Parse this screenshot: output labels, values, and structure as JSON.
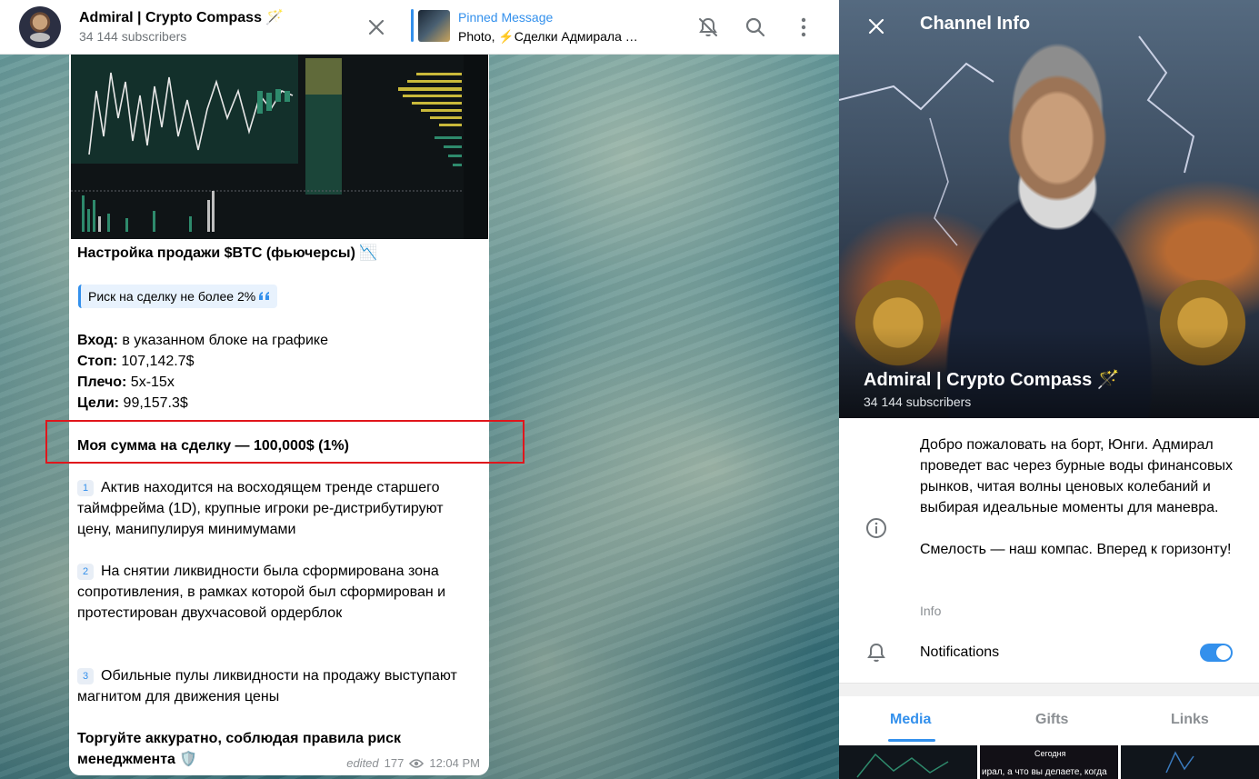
{
  "chat_header": {
    "title": "Admiral | Crypto Compass 🪄",
    "subscribers": "34 144 subscribers"
  },
  "pinned": {
    "title": "Pinned Message",
    "text": "Photo, ⚡Сделки Адмирала …"
  },
  "icons": {
    "close": "close-icon",
    "mute": "bell-off-icon",
    "search": "search-icon",
    "more": "more-vertical-icon",
    "info": "info-icon",
    "notifications": "bell-icon",
    "views": "eye-icon"
  },
  "message": {
    "heading": "Настройка продажи $BTC (фьючерсы) 📉",
    "risk_quote": "Риск на сделку не более 2%",
    "entry_label": "Вход:",
    "entry_value": " в указанном блоке на графике",
    "stop_label": "Стоп:",
    "stop_value": " 107,142.7$",
    "leverage_label": "Плечо:",
    "leverage_value": " 5x-15x",
    "targets_label": "Цели:",
    "targets_value": " 99,157.3$",
    "my_amount": "Моя сумма на сделку — 100,000$ (1%)",
    "points": [
      {
        "num": "1",
        "text": "Актив находится на восходящем тренде старшего таймфрейма (1D), крупные игроки ре-дистрибутируют цену, манипулируя минимумами"
      },
      {
        "num": "2",
        "text": "На снятии ликвидности была сформирована зона сопротивления, в рамках которой был сформирован и протестирован двухчасовой ордерблок"
      },
      {
        "num": "3",
        "text": "Обильные пулы ликвидности на продажу выступают магнитом для движения цены"
      }
    ],
    "closing": "Торгуйте аккуратно, соблюдая правила риск менеджмента 🛡️",
    "edited": "edited",
    "views": "177",
    "time": "12:04 PM"
  },
  "panel": {
    "header": "Channel Info",
    "name": "Admiral | Crypto Compass 🪄",
    "subscribers": "34 144 subscribers",
    "info_text_1": "Добро пожаловать на борт, Юнги. Адмирал проведет вас через бурные воды финансовых рынков, читая волны ценовых колебаний и выбирая идеальные моменты для маневра.",
    "info_text_2": "Смелость — наш компас. Вперед к горизонту!",
    "info_label": "Info",
    "notifications_label": "Notifications",
    "notifications_on": true,
    "tabs": [
      "Media",
      "Gifts",
      "Links"
    ],
    "active_tab": "Media",
    "thumb_captions": {
      "today": "Сегодня",
      "snippet": "ирал, а что вы делаете, когда"
    }
  },
  "colors": {
    "accent": "#3390ec",
    "highlight_box": "#e0161c",
    "secondary_text": "#707579"
  }
}
